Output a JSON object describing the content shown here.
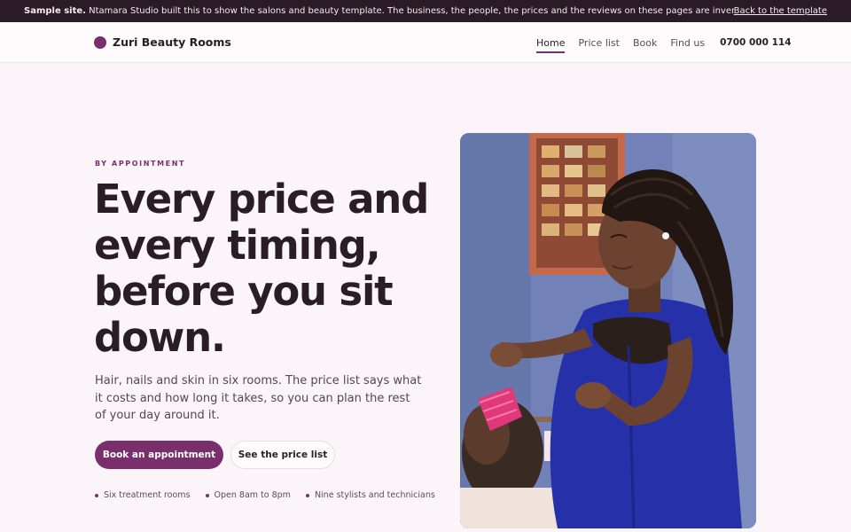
{
  "banner": {
    "label": "Sample site.",
    "text": "Ntamara Studio built this to show the salons and beauty template. The business, the people, the prices and the reviews on these pages are invented.",
    "link": "Back to the template"
  },
  "header": {
    "brand": "Zuri Beauty Rooms",
    "nav": [
      {
        "label": "Home",
        "active": true
      },
      {
        "label": "Price list"
      },
      {
        "label": "Book"
      },
      {
        "label": "Find us"
      }
    ],
    "phone": "0700 000 114"
  },
  "hero": {
    "eyebrow": "BY APPOINTMENT",
    "headline": "Every price and every timing, before you sit down.",
    "lead": "Hair, nails and skin in six rooms. The price list says what it costs and how long it takes, so you can plan the rest of your day around it.",
    "primary_cta": "Book an appointment",
    "secondary_cta": "See the price list",
    "facts": [
      "Six treatment rooms",
      "Open 8am to 8pm",
      "Nine stylists and technicians"
    ]
  },
  "colors": {
    "brand": "#7a2f6d",
    "banner_bg": "#2a1b26",
    "page_bg": "#fbf5f9"
  }
}
